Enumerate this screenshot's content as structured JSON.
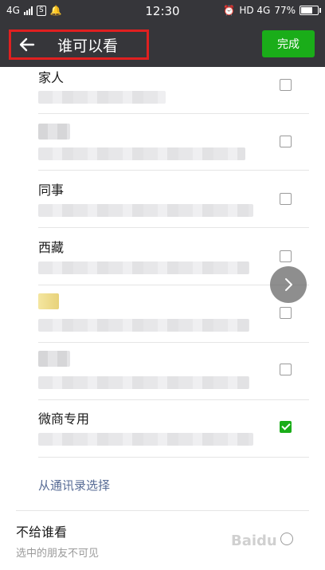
{
  "status_bar": {
    "network": "4G",
    "time": "12:30",
    "right_network": "HD 4G",
    "battery": "77%",
    "battery_level": 0.77
  },
  "header": {
    "title": "谁可以看",
    "done_label": "完成"
  },
  "groups": [
    {
      "name": "家人",
      "checked": false
    },
    {
      "name": "",
      "checked": false
    },
    {
      "name": "同事",
      "checked": false
    },
    {
      "name": "西藏",
      "checked": false
    },
    {
      "name": "",
      "checked": false
    },
    {
      "name": "",
      "checked": false
    },
    {
      "name": "微商专用",
      "checked": true
    }
  ],
  "contacts_link": "从通讯录选择",
  "not_visible": {
    "title": "不给谁看",
    "subtitle": "选中的朋友不可见"
  },
  "watermark": "Baidu",
  "colors": {
    "header_bg": "#36363a",
    "accent_green": "#1aad19",
    "link_blue": "#576b95",
    "highlight_red": "#e02020"
  }
}
